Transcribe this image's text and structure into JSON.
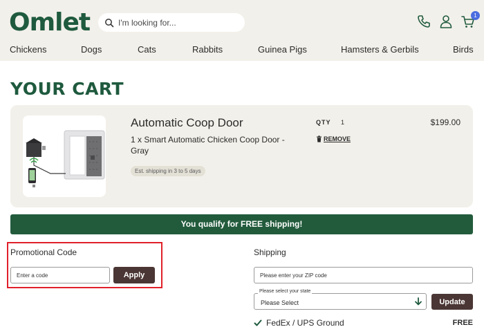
{
  "header": {
    "logo": "Omlet",
    "search_placeholder": "I'm looking for...",
    "cart_count": "1"
  },
  "nav": [
    {
      "label": "Chickens"
    },
    {
      "label": "Dogs"
    },
    {
      "label": "Cats"
    },
    {
      "label": "Rabbits"
    },
    {
      "label": "Guinea Pigs"
    },
    {
      "label": "Hamsters & Gerbils"
    },
    {
      "label": "Birds"
    }
  ],
  "page_title": "YOUR CART",
  "cart_item": {
    "name": "Automatic Coop Door",
    "description": "1 x Smart Automatic Chicken Coop Door - Gray",
    "shipping_estimate": "Est. shipping in 3 to 5 days",
    "qty_label": "QTY",
    "qty": "1",
    "remove_label": "REMOVE",
    "price": "$199.00"
  },
  "free_shipping_banner": "You qualify for FREE shipping!",
  "promo": {
    "label": "Promotional Code",
    "placeholder": "Enter a code",
    "apply_label": "Apply"
  },
  "shipping": {
    "label": "Shipping",
    "zip_placeholder": "Please enter your ZIP code",
    "state_legend": "Please select your state",
    "state_value": "Please Select",
    "update_label": "Update",
    "method_label": "FedEx / UPS Ground",
    "method_price": "FREE"
  },
  "colors": {
    "brand_green": "#1f5a3e",
    "banner_green": "#225b3c",
    "button_brown": "#4a3634",
    "header_bg": "#f2f0ea",
    "highlight_red": "#e0202a"
  }
}
